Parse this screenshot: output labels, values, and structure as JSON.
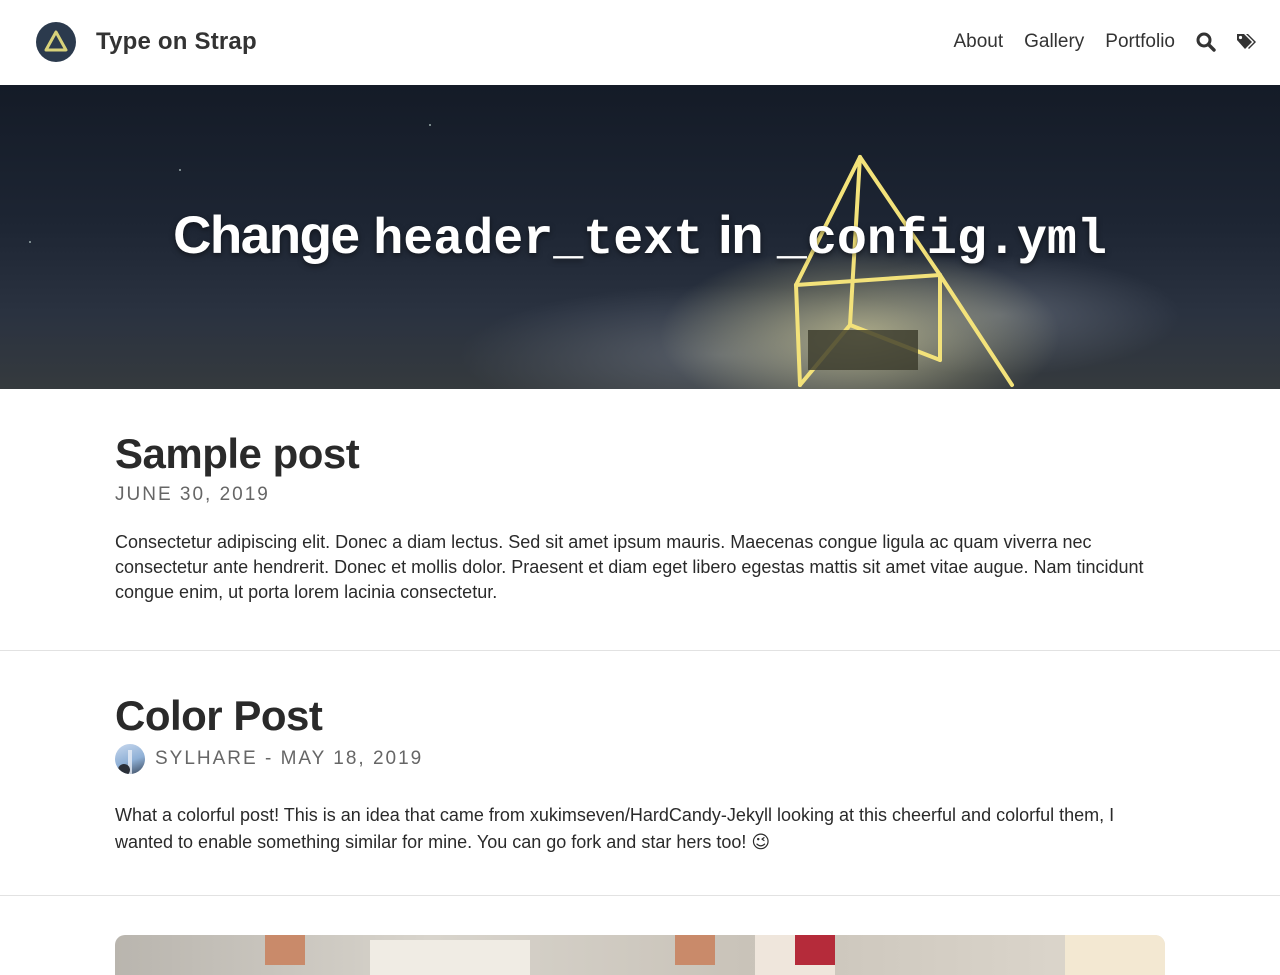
{
  "site": {
    "title": "Type on Strap",
    "logo_icon": "triangle-logo-icon"
  },
  "nav": {
    "links": [
      {
        "label": "About"
      },
      {
        "label": "Gallery"
      },
      {
        "label": "Portfolio"
      }
    ],
    "icons": [
      "search-icon",
      "tags-icon"
    ]
  },
  "hero": {
    "title_part1": "Change",
    "title_part2": "header_text",
    "title_part3": "in",
    "title_part4": "_config.yml"
  },
  "posts": [
    {
      "title": "Sample post",
      "meta": "JUNE 30, 2019",
      "excerpt": "Consectetur adipiscing elit. Donec a diam lectus. Sed sit amet ipsum mauris. Maecenas congue ligula ac quam viverra nec consectetur ante hendrerit. Donec et mollis dolor. Praesent et diam eget libero egestas mattis sit amet vitae augue. Nam tincidunt congue enim, ut porta lorem lacinia consectetur."
    },
    {
      "title": "Color Post",
      "meta": "SYLHARE - MAY 18, 2019",
      "excerpt": "What a colorful post! This is an idea that came from xukimseven/HardCandy-Jekyll looking at this cheerful and colorful them, I wanted to enable something similar for mine. You can go fork and star hers too! 😉"
    }
  ],
  "colors": {
    "text": "#2a2a2a",
    "meta": "#666666",
    "logo_bg": "#2b3a4d",
    "logo_triangle": "#d8d27a",
    "divider": "#e2e2e2"
  }
}
